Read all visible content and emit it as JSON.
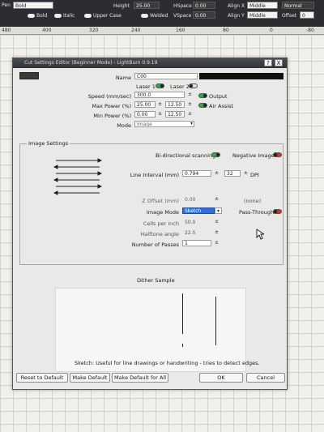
{
  "toolbar": {
    "pen_value": "Bold",
    "height_label": "Height",
    "height_value": "25.00",
    "hspace_label": "HSpace",
    "hspace_value": "0.00",
    "align_x_label": "Align X",
    "align_x_value": "Middle",
    "normal_label": "Normal",
    "bold_label": "Bold",
    "italic_label": "Italic",
    "upper_case_label": "Upper Case",
    "welded_label": "Welded",
    "vspace_label": "VSpace",
    "vspace_value": "0.00",
    "align_y_label": "Align Y",
    "align_y_value": "Middle",
    "offset_label": "Offset",
    "offset_value": "0"
  },
  "ruler": [
    "480",
    "400",
    "320",
    "240",
    "160",
    "80",
    "0",
    "-80"
  ],
  "dialog": {
    "title": "Cut Settings Editor (Beginner Mode) - LightBurn 0.9.19",
    "name_label": "Name",
    "name_value": "C00",
    "laser1_label": "Laser 1",
    "laser2_label": "Laser 2",
    "speed_label": "Speed (mm/sec)",
    "speed_value": "300.0",
    "output_label": "Output",
    "max_power_label": "Max Power (%)",
    "max_power_1": "25.00",
    "max_power_2": "12.50",
    "air_assist_label": "Air Assist",
    "min_power_label": "Min Power (%)",
    "min_power_1": "0.00",
    "min_power_2": "12.50",
    "mode_label": "Mode",
    "mode_value": "Image",
    "image_settings_title": "Image Settings",
    "bidir_label": "Bi-directional scanning",
    "negative_label": "Negative Image",
    "line_interval_label": "Line Interval (mm)",
    "line_interval_value": "0.794",
    "dpi_value": "32",
    "dpi_label": "DPI",
    "z_offset_label": "Z Offset (mm)",
    "z_offset_value": "0.00",
    "none_label": "(none)",
    "image_mode_label": "Image Mode",
    "image_mode_value": "Sketch",
    "pass_through_label": "Pass-Through",
    "cells_label": "Cells per inch",
    "cells_value": "50.0",
    "halftone_label": "Halftone angle",
    "halftone_value": "22.5",
    "passes_label": "Number of Passes",
    "passes_value": "1",
    "dither_label": "Dither Sample",
    "description": "Sketch: Useful for line drawings or handwriting - tries to detect edges.",
    "reset_button": "Reset to Default",
    "make_default_button": "Make Default",
    "make_default_all_button": "Make Default for All",
    "ok_button": "OK",
    "cancel_button": "Cancel",
    "help_button": "?",
    "close_button": "X"
  },
  "colors": {
    "toggle_on": "#2fa84f",
    "toggle_red": "#c0392b",
    "selection": "#2d6fd6"
  }
}
